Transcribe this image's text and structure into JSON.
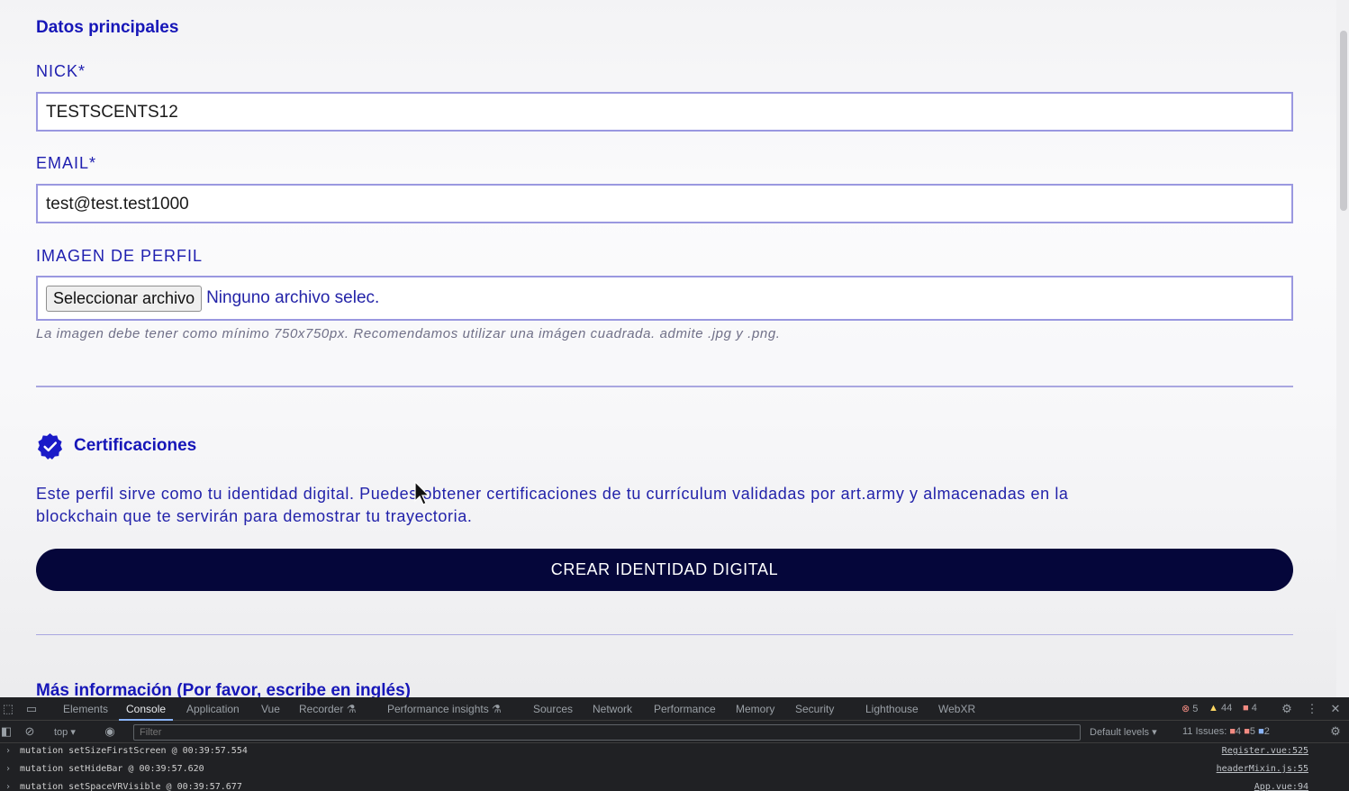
{
  "form": {
    "section_main": "Datos principales",
    "nick_label": "NICK*",
    "nick_value": "TESTSCENTS12",
    "email_label": "EMAIL*",
    "email_value": "test@test.test1000",
    "image_label": "IMAGEN DE PERFIL",
    "file_button": "Seleccionar archivo",
    "file_status": "Ninguno archivo selec.",
    "image_hint": "La imagen debe tener como mínimo 750x750px. Recomendamos utilizar una imágen cuadrada. admite .jpg y .png.",
    "section_cert": "Certificaciones",
    "cert_description": "Este perfil sirve como tu identidad digital. Puedes obtener certificaciones de tu currículum validadas por art.army y almacenadas en la blockchain que te servirán para demostrar tu trayectoria.",
    "cta_label": "CREAR IDENTIDAD DIGITAL",
    "section_more": "Más información (Por favor, escribe en inglés)"
  },
  "devtools": {
    "tabs": [
      "Elements",
      "Console",
      "Application",
      "Vue",
      "Recorder ⚗",
      "Performance insights ⚗",
      "Sources",
      "Network",
      "Performance",
      "Memory",
      "Security",
      "Lighthouse",
      "WebXR"
    ],
    "active_tab": "Console",
    "error_count": "5",
    "warning_count": "44",
    "message_count": "4",
    "context": "top",
    "filter_placeholder": "Filter",
    "levels": "Default levels",
    "issues_label": "11 Issues:",
    "issues_errors": "4",
    "issues_warnings": "5",
    "issues_info": "2",
    "logs": [
      {
        "message": "mutation setSizeFirstScreen @ 00:39:57.554",
        "source": "Register.vue:525"
      },
      {
        "message": "mutation setHideBar @ 00:39:57.620",
        "source": "headerMixin.js:55"
      },
      {
        "message": "mutation setSpaceVRVisible @ 00:39:57.677",
        "source": "App.vue:94"
      }
    ]
  },
  "colors": {
    "accent": "#1616b8",
    "cta_bg": "#05063a",
    "field_border": "#9a98e0"
  }
}
